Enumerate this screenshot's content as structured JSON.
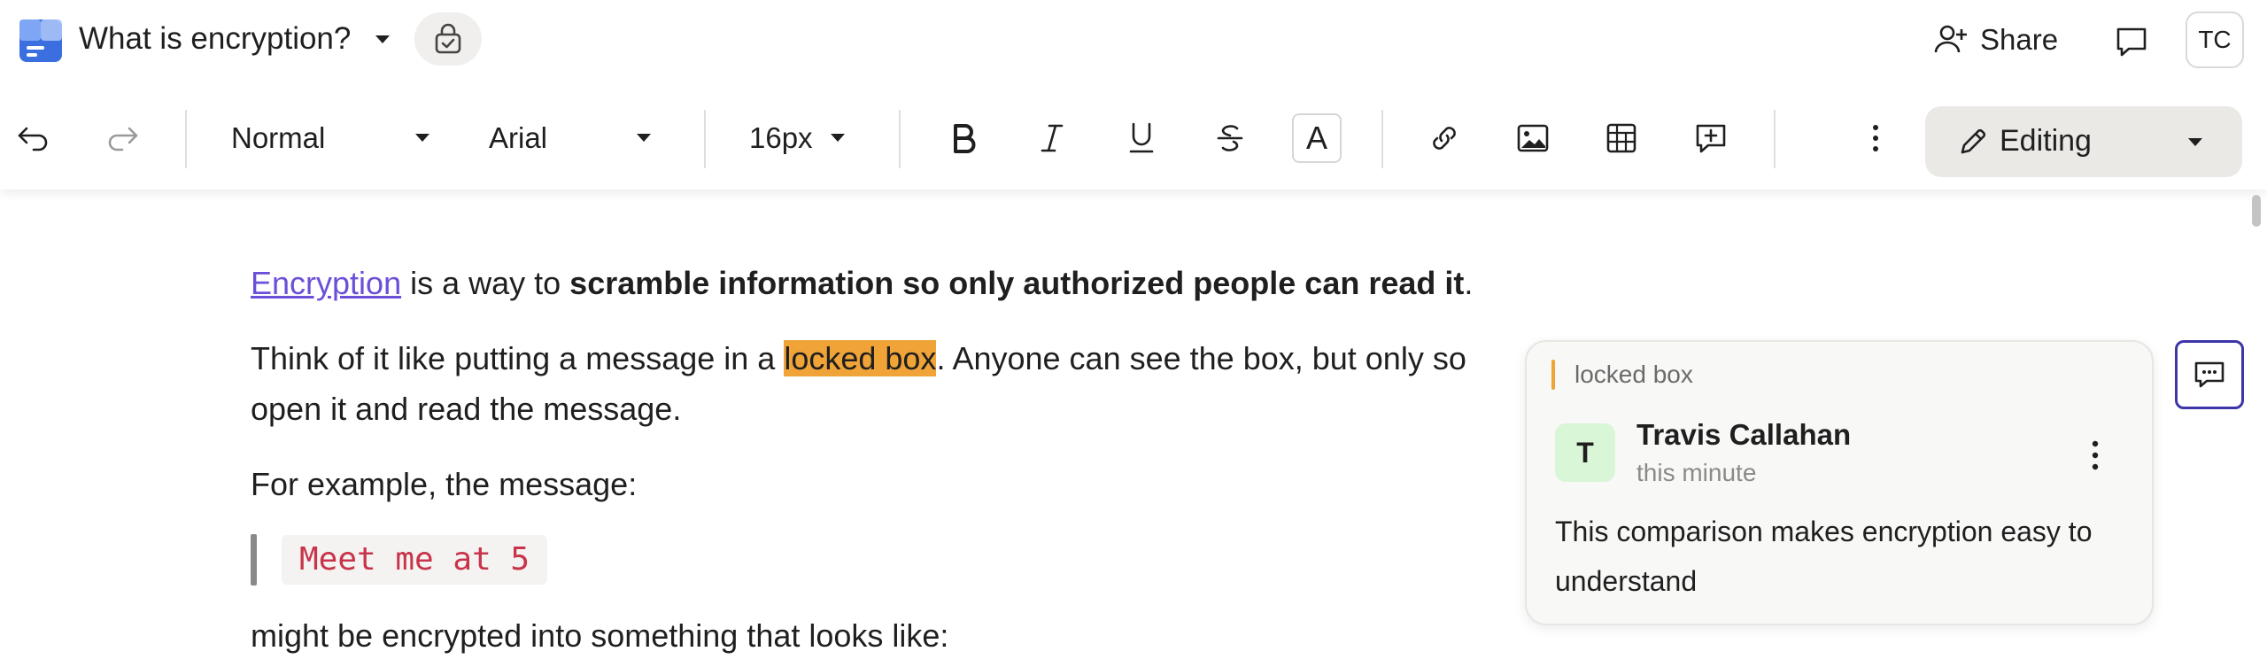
{
  "header": {
    "doc_title": "What is encryption?",
    "share_label": "Share",
    "avatar_initials": "TC"
  },
  "toolbar": {
    "style_select": "Normal",
    "font_select": "Arial",
    "size_select": "16px",
    "font_color_glyph": "A",
    "mode_label": "Editing"
  },
  "document": {
    "p1": {
      "link": "Encryption",
      "mid": " is a way to ",
      "bold": "scramble information so only authorized people can read it",
      "end": "."
    },
    "p2": {
      "start": "Think of it like putting a message in a ",
      "highlight": "locked box",
      "end": ". Anyone can see the box, but only so",
      "line2": "open it and read the message."
    },
    "p3": "For example, the message:",
    "code": "Meet me at 5",
    "p4": "might be encrypted into something that looks like:"
  },
  "comment": {
    "quote": "locked box",
    "avatar_initial": "T",
    "author": "Travis Callahan",
    "time": "this minute",
    "text": "This comparison makes encryption easy to understand"
  },
  "colors": {
    "link": "#6b4fd8",
    "highlight": "#f0a337",
    "code_text": "#c8344a",
    "side_comment_border": "#3d35a8",
    "comment_avatar_bg": "#d9f6d7"
  },
  "icons": {
    "doc": "document-icon",
    "lock": "lock-check-icon",
    "share": "add-user-icon",
    "comments": "chat-bubble-icon",
    "undo": "undo-icon",
    "redo": "redo-icon",
    "bold": "bold-icon",
    "italic": "italic-icon",
    "underline": "underline-icon",
    "strike": "strikethrough-icon",
    "link": "link-icon",
    "image": "image-icon",
    "table": "table-icon",
    "add_comment": "add-comment-icon",
    "more": "more-vertical-icon",
    "pencil": "pencil-icon"
  }
}
